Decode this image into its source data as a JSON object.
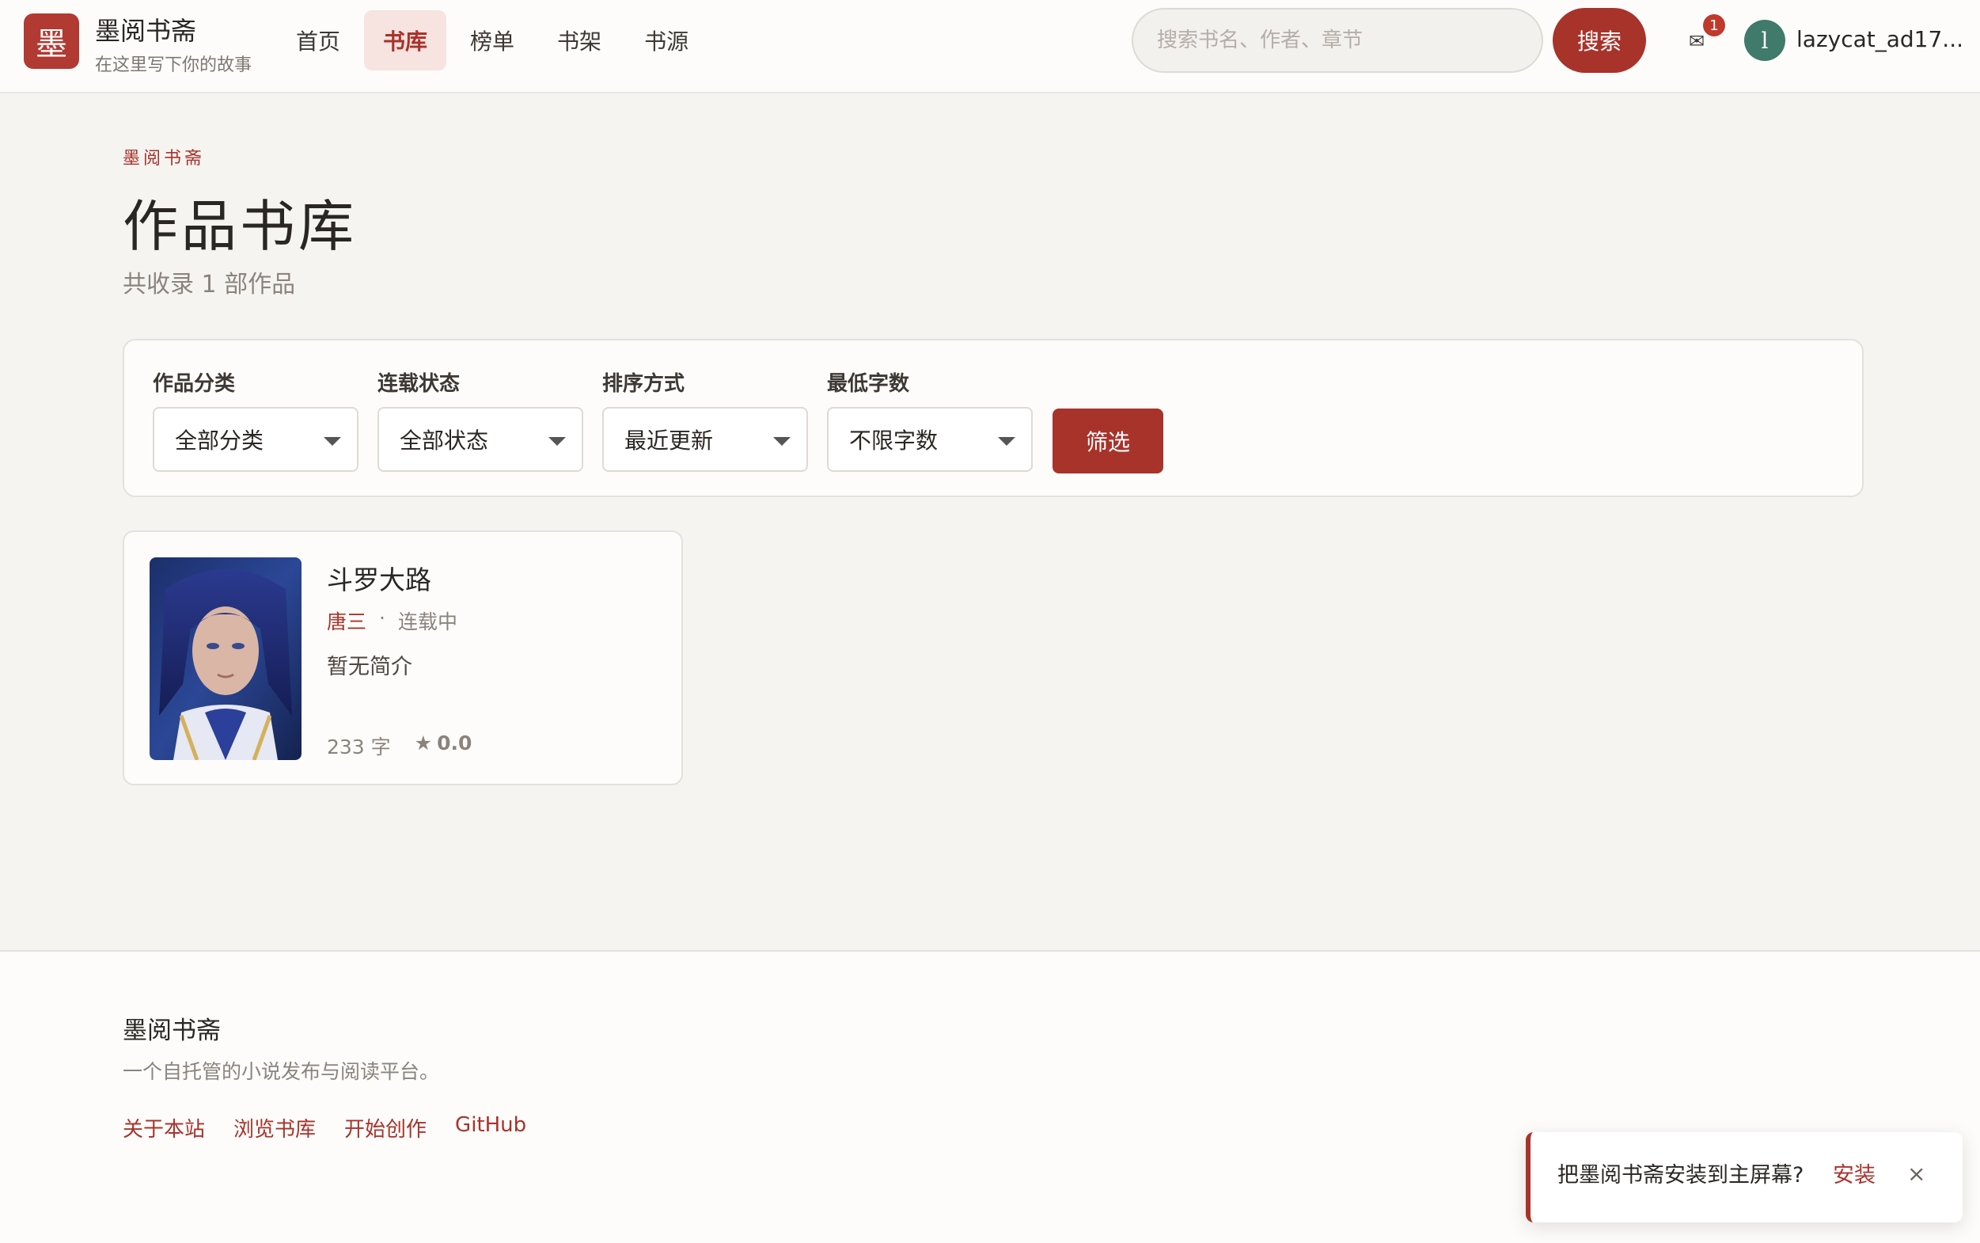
{
  "header": {
    "logo_char": "墨",
    "brand_name": "墨阅书斋",
    "brand_sub": "在这里写下你的故事",
    "nav": [
      {
        "label": "首页",
        "active": false
      },
      {
        "label": "书库",
        "active": true
      },
      {
        "label": "榜单",
        "active": false
      },
      {
        "label": "书架",
        "active": false
      },
      {
        "label": "书源",
        "active": false
      }
    ],
    "search_placeholder": "搜索书名、作者、章节",
    "search_value": "",
    "search_button": "搜索",
    "mail_icon": "✉",
    "mail_badge": "1",
    "avatar_letter": "l",
    "username": "lazycat_ad17..."
  },
  "page": {
    "kicker": "墨阅书斋",
    "title": "作品书库",
    "count_text": "共收录 1 部作品"
  },
  "filters": {
    "category": {
      "label": "作品分类",
      "value": "全部分类"
    },
    "status": {
      "label": "连载状态",
      "value": "全部状态"
    },
    "sort": {
      "label": "排序方式",
      "value": "最近更新"
    },
    "min_words": {
      "label": "最低字数",
      "value": "不限字数"
    },
    "submit": "筛选"
  },
  "books": [
    {
      "title": "斗罗大路",
      "author": "唐三",
      "separator": "·",
      "status": "连载中",
      "description": "暂无简介",
      "words": "233 字",
      "star": "★",
      "score": "0.0"
    }
  ],
  "footer": {
    "title": "墨阅书斋",
    "description": "一个自托管的小说发布与阅读平台。",
    "links": [
      "关于本站",
      "浏览书库",
      "开始创作",
      "GitHub"
    ]
  },
  "toast": {
    "text": "把墨阅书斋安装到主屏幕?",
    "install": "安装",
    "close": "×"
  },
  "colors": {
    "accent": "#a8332b",
    "background": "#f5f4f1",
    "surface": "#fdfcfa",
    "avatar": "#3f7a6a"
  }
}
